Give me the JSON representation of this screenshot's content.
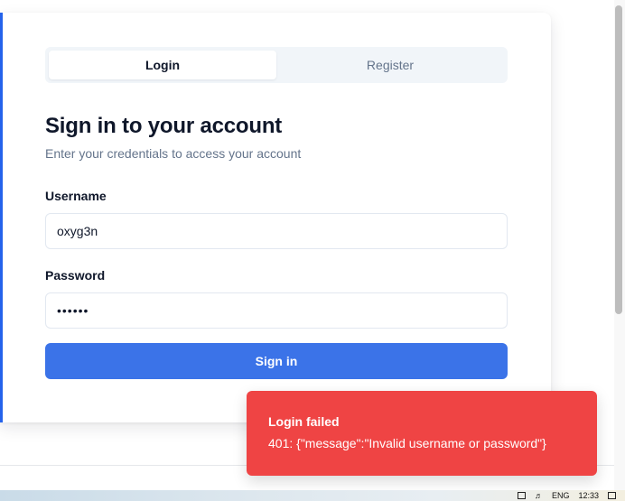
{
  "tabs": [
    {
      "label": "Login",
      "active": true
    },
    {
      "label": "Register",
      "active": false
    }
  ],
  "form": {
    "title": "Sign in to your account",
    "subtitle": "Enter your credentials to access your account",
    "username_label": "Username",
    "username_value": "oxyg3n",
    "password_label": "Password",
    "password_value": "••••••",
    "submit_label": "Sign in"
  },
  "toast": {
    "title": "Login failed",
    "message": "401: {\"message\":\"Invalid username or password\"}"
  },
  "taskbar": {
    "language": "ENG",
    "clock": "12:33"
  },
  "colors": {
    "accent": "#3b73e8",
    "card_border": "#2563eb",
    "error": "#ef4444"
  }
}
